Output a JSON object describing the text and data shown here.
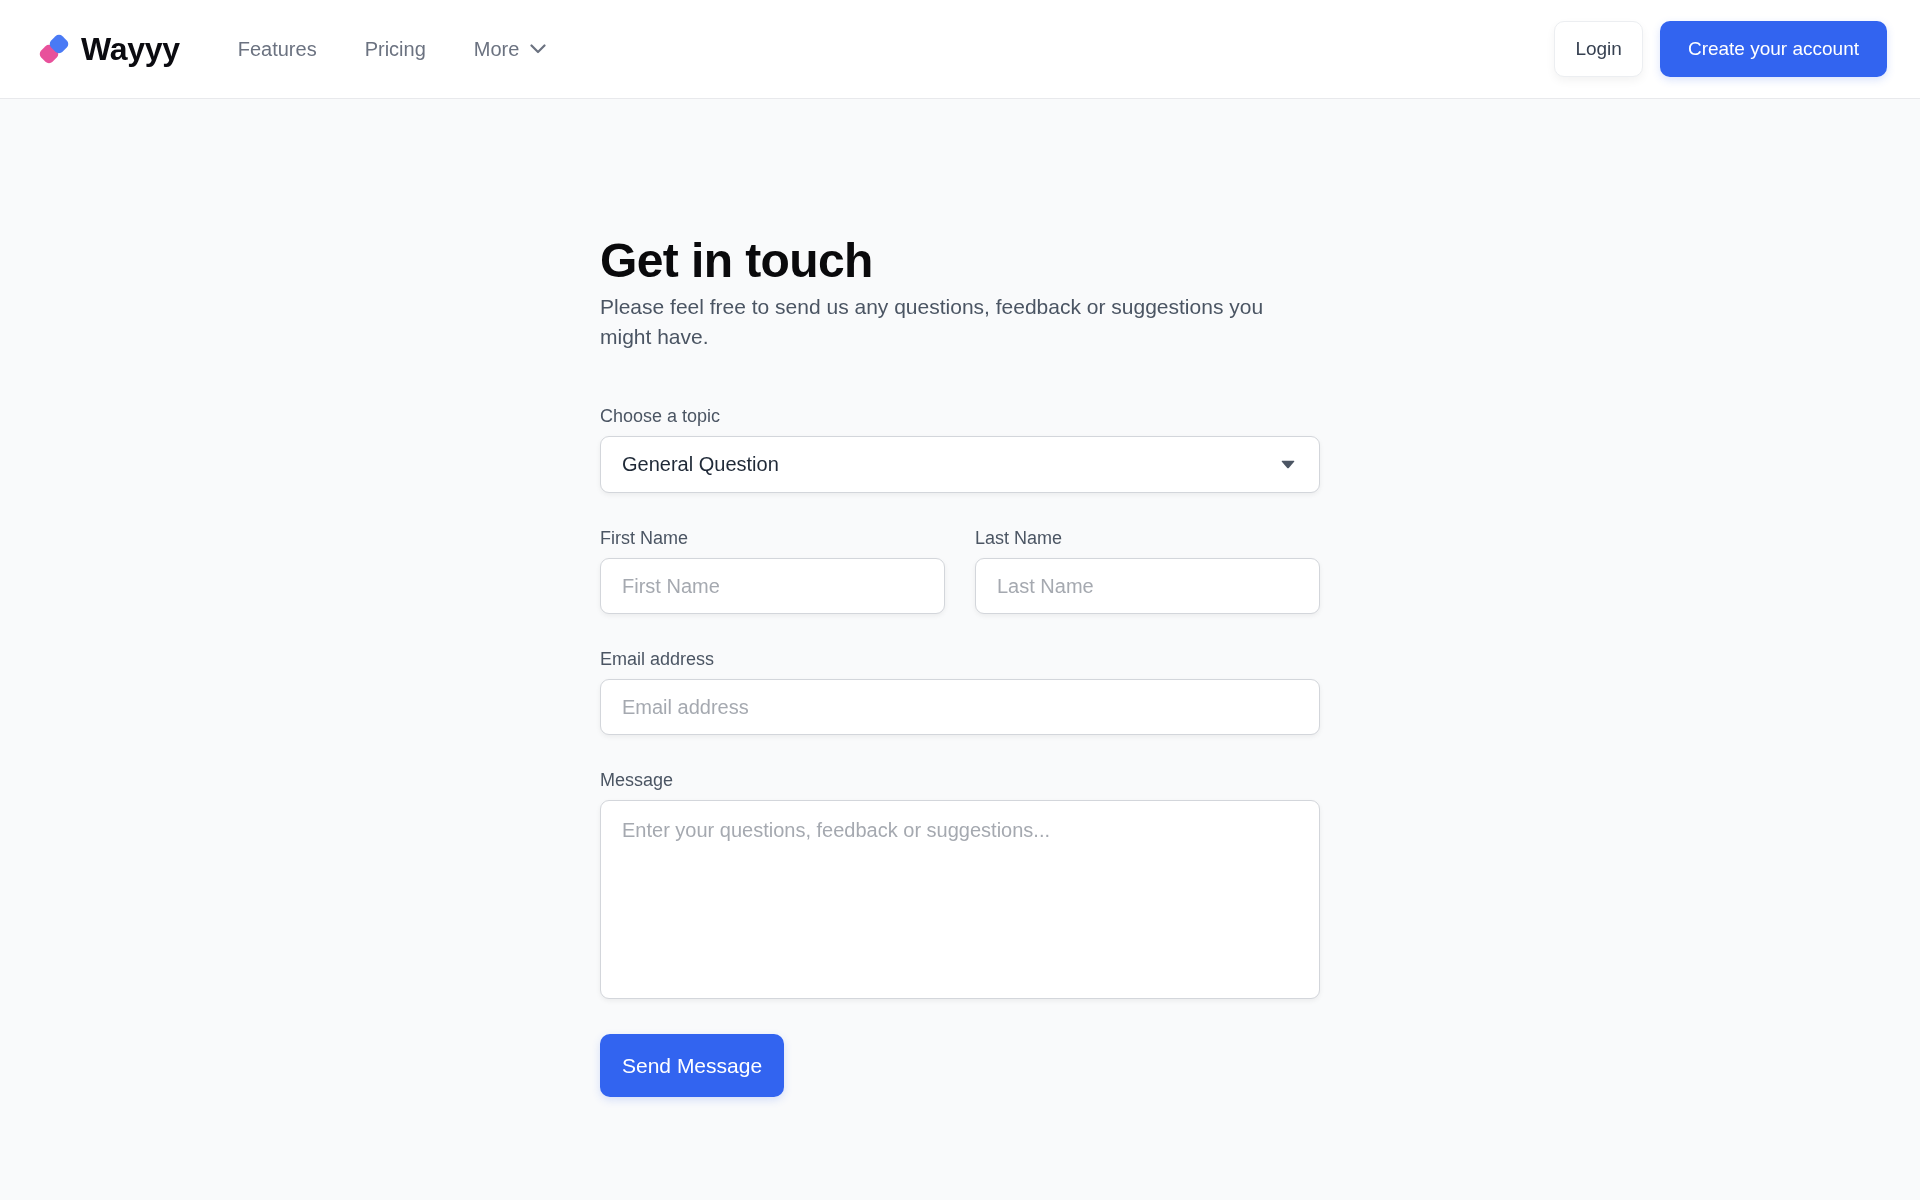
{
  "header": {
    "brand": "Wayyy",
    "nav": [
      {
        "label": "Features",
        "kind": "link"
      },
      {
        "label": "Pricing",
        "kind": "link"
      },
      {
        "label": "More",
        "kind": "dropdown"
      }
    ],
    "actions": [
      {
        "label": "Login",
        "kind": "secondary"
      },
      {
        "label": "Create your account",
        "kind": "primary"
      }
    ]
  },
  "contact_form": {
    "title": "Get in touch",
    "subtitle": "Please feel free to send us any questions, feedback or suggestions you might have.",
    "rows": [
      [
        {
          "kind": "select",
          "label": "Choose a topic",
          "value": "General Question"
        }
      ],
      [
        {
          "kind": "input",
          "label": "First Name",
          "placeholder": "First Name"
        },
        {
          "kind": "input",
          "label": "Last Name",
          "placeholder": "Last Name"
        }
      ],
      [
        {
          "kind": "input",
          "label": "Email address",
          "placeholder": "Email address"
        }
      ],
      [
        {
          "kind": "textarea",
          "label": "Message",
          "placeholder": "Enter your questions, feedback or suggestions..."
        }
      ]
    ],
    "submit": "Send Message"
  }
}
